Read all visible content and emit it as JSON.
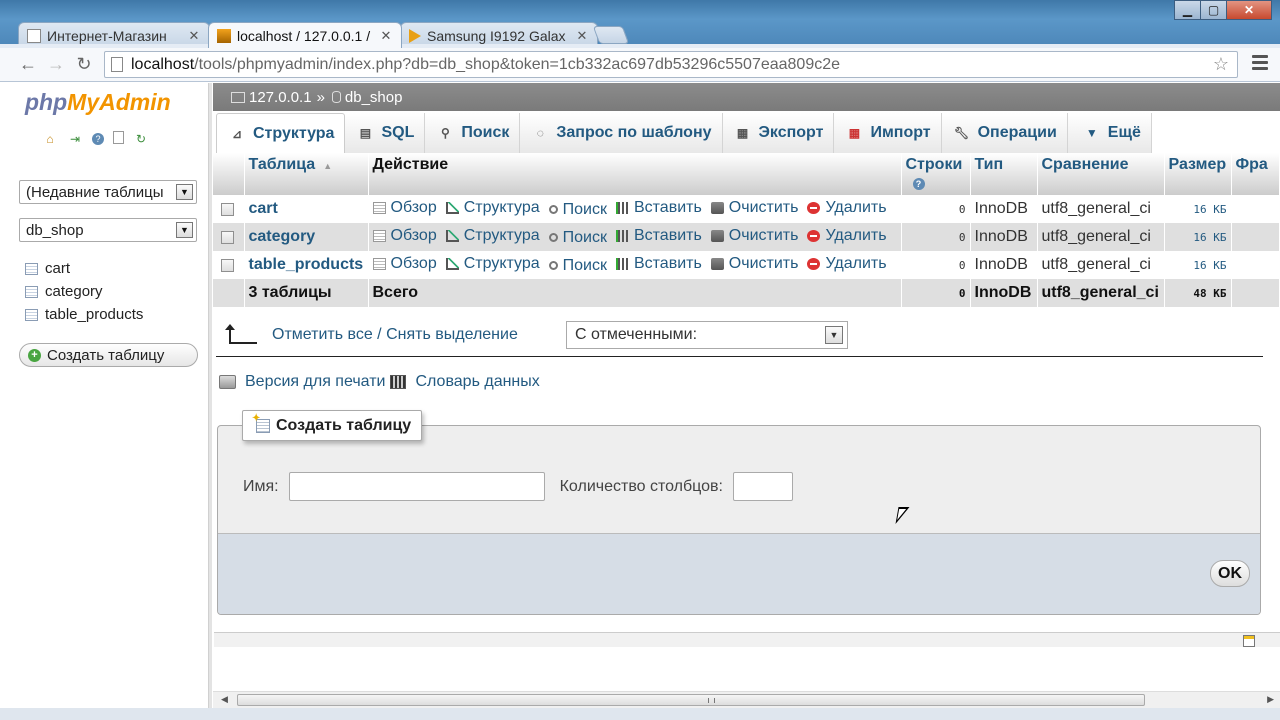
{
  "browser": {
    "tabs": [
      {
        "title": "Интернет-Магазин",
        "active": false
      },
      {
        "title": "localhost / 127.0.0.1 /",
        "active": true
      },
      {
        "title": "Samsung I9192 Galax",
        "active": false
      }
    ],
    "url_host": "localhost",
    "url_path": "/tools/phpmyadmin/index.php?db=db_shop&token=1cb332ac697db53296c5507eaa809c2e"
  },
  "sidebar": {
    "logo_php": "php",
    "logo_myadmin": "MyAdmin",
    "recent_tables": "(Недавние таблицы",
    "database": "db_shop",
    "tables": [
      "cart",
      "category",
      "table_products"
    ],
    "create_table": "Создать таблицу"
  },
  "breadcrumb": {
    "server": "127.0.0.1",
    "separator": "»",
    "db": "db_shop"
  },
  "topnav": {
    "structure": "Структура",
    "sql": "SQL",
    "search": "Поиск",
    "query": "Запрос по шаблону",
    "export": "Экспорт",
    "import": "Импорт",
    "operations": "Операции",
    "more": "Ещё"
  },
  "table": {
    "headers": {
      "table": "Таблица",
      "action": "Действие",
      "rows": "Строки",
      "type": "Тип",
      "collation": "Сравнение",
      "size": "Размер",
      "overhead": "Фра"
    },
    "actions": {
      "browse": "Обзор",
      "structure": "Структура",
      "search": "Поиск",
      "insert": "Вставить",
      "empty": "Очистить",
      "drop": "Удалить"
    },
    "rows": [
      {
        "name": "cart",
        "rows": "0",
        "type": "InnoDB",
        "collation": "utf8_general_ci",
        "size": "16 КБ"
      },
      {
        "name": "category",
        "rows": "0",
        "type": "InnoDB",
        "collation": "utf8_general_ci",
        "size": "16 КБ"
      },
      {
        "name": "table_products",
        "rows": "0",
        "type": "InnoDB",
        "collation": "utf8_general_ci",
        "size": "16 КБ"
      }
    ],
    "total": {
      "name": "3 таблицы",
      "label": "Всего",
      "rows": "0",
      "type": "InnoDB",
      "collation": "utf8_general_ci",
      "size": "48 КБ"
    }
  },
  "bulk": {
    "check_all": "Отметить все / Снять выделение",
    "with_selected": "С отмеченными:"
  },
  "links": {
    "print": "Версия для печати",
    "dictionary": "Словарь данных"
  },
  "create_form": {
    "legend": "Создать таблицу",
    "name_label": "Имя:",
    "columns_label": "Количество столбцов:",
    "ok": "OK"
  }
}
